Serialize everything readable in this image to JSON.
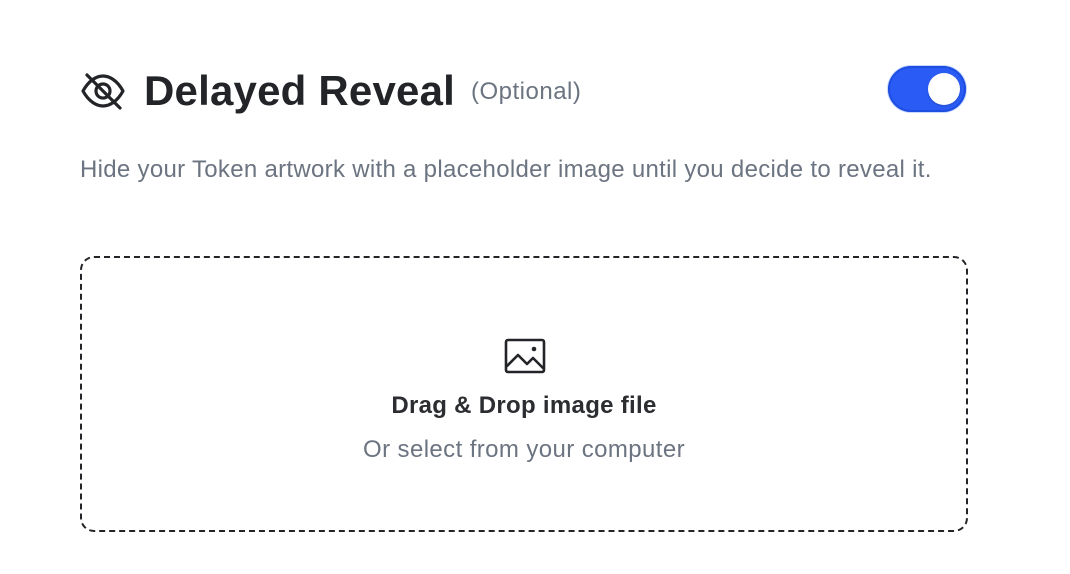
{
  "section": {
    "title": "Delayed Reveal",
    "optional_label": "(Optional)",
    "title_icon": "eye-off-icon",
    "toggle": {
      "state": "on",
      "color": "#2a5cf5"
    },
    "description": "Hide your Token artwork with a placeholder image until you decide to reveal it."
  },
  "dropzone": {
    "icon": "image-icon",
    "title": "Drag & Drop image file",
    "subtitle": "Or select from your computer"
  }
}
